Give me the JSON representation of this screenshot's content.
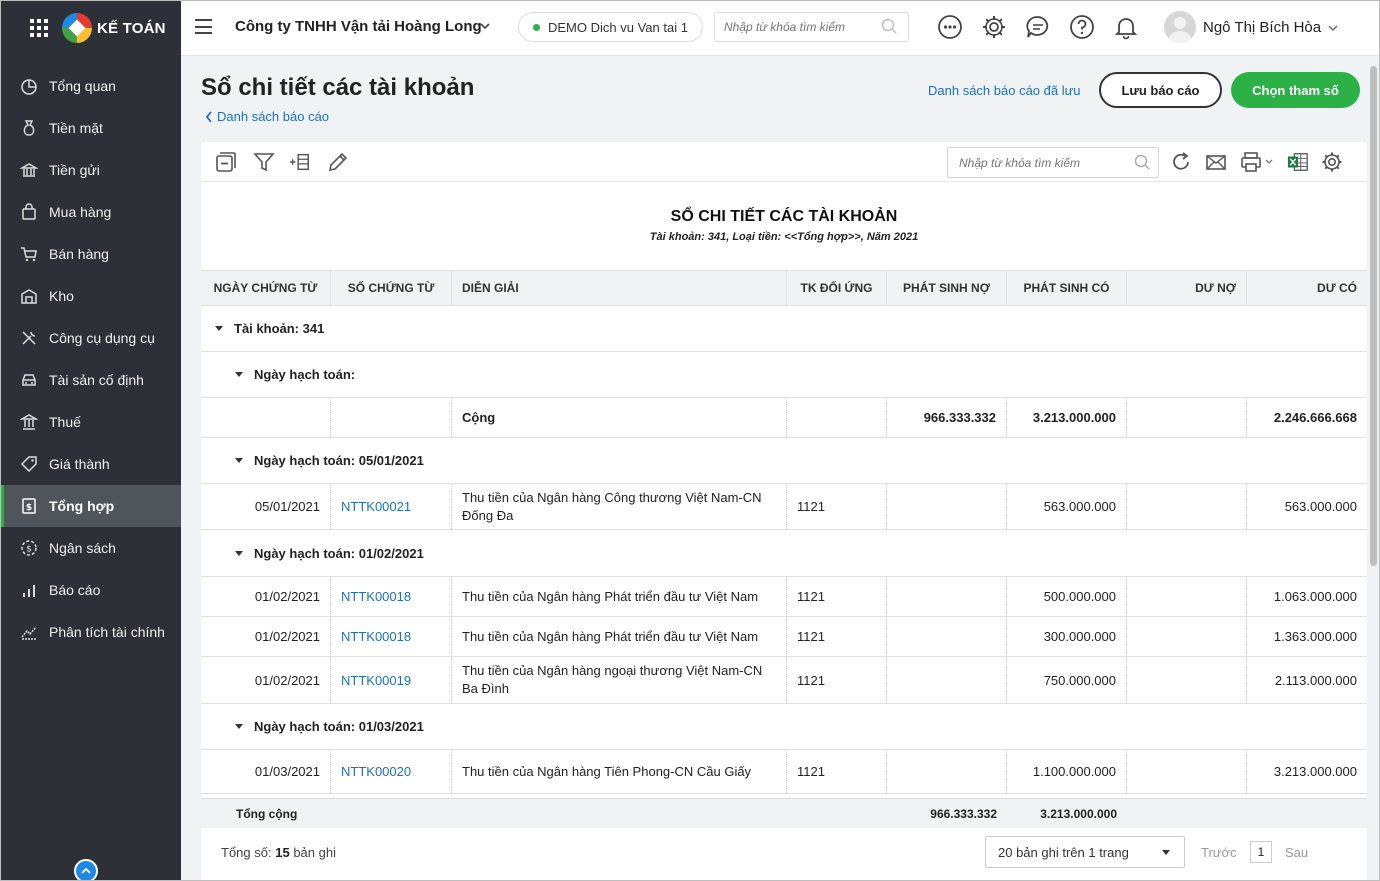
{
  "sidebar": {
    "brand": "KẾ TOÁN",
    "items": [
      {
        "label": "Tổng quan",
        "icon": "dashboard-icon"
      },
      {
        "label": "Tiền mặt",
        "icon": "cash-bag-icon"
      },
      {
        "label": "Tiền gửi",
        "icon": "bank-icon"
      },
      {
        "label": "Mua hàng",
        "icon": "shopping-bag-icon"
      },
      {
        "label": "Bán hàng",
        "icon": "cart-icon"
      },
      {
        "label": "Kho",
        "icon": "warehouse-icon"
      },
      {
        "label": "Công cụ dụng cụ",
        "icon": "tools-icon"
      },
      {
        "label": "Tài sản cố định",
        "icon": "car-icon"
      },
      {
        "label": "Thuế",
        "icon": "tax-building-icon"
      },
      {
        "label": "Giá thành",
        "icon": "price-tag-icon"
      },
      {
        "label": "Tổng hợp",
        "icon": "ledger-icon",
        "active": true
      },
      {
        "label": "Ngân sách",
        "icon": "budget-coin-icon"
      },
      {
        "label": "Báo cáo",
        "icon": "bar-chart-icon"
      },
      {
        "label": "Phân tích tài chính",
        "icon": "trend-chart-icon"
      }
    ]
  },
  "topbar": {
    "company": "Công ty TNHH Vận tải Hoàng Long",
    "demo_label": "DEMO Dich vu Van tai 1",
    "search_placeholder": "Nhập từ khóa tìm kiếm",
    "username": "Ngô Thị Bích Hòa"
  },
  "page": {
    "title": "Sổ chi tiết các tài khoản",
    "back_link": "Danh sách báo cáo",
    "saved_reports_link": "Danh sách báo cáo đã lưu",
    "save_button": "Lưu báo cáo",
    "param_button": "Chọn tham số"
  },
  "toolbar": {
    "search_placeholder": "Nhập từ khóa tìm kiếm"
  },
  "report": {
    "title": "SỔ CHI TIẾT CÁC TÀI KHOẢN",
    "subtitle": "Tài khoản: 341, Loại tiền: <<Tổng hợp>>, Năm 2021"
  },
  "table": {
    "headers": {
      "date": "NGÀY CHỨNG TỪ",
      "voucher": "SỐ CHỨNG TỪ",
      "desc": "DIỄN GIẢI",
      "corr": "TK ĐỐI ỨNG",
      "debit": "PHÁT SINH NỢ",
      "credit": "PHÁT SINH CÓ",
      "bal_debit": "DƯ NỢ",
      "bal_credit": "DƯ CÓ"
    },
    "account_group": "Tài khoản: 341",
    "group_opening": "Ngày hạch toán:",
    "sum_row": {
      "label": "Cộng",
      "debit": "966.333.332",
      "credit": "3.213.000.000",
      "bal_credit": "2.246.666.668"
    },
    "group_1": "Ngày hạch toán: 05/01/2021",
    "row_1": {
      "date": "05/01/2021",
      "voucher": "NTTK00021",
      "desc": "Thu tiền của Ngân hàng Công thương Việt Nam-CN Đống Đa",
      "corr": "1121",
      "credit": "563.000.000",
      "bal_credit": "563.000.000"
    },
    "group_2": "Ngày hạch toán: 01/02/2021",
    "row_2": {
      "date": "01/02/2021",
      "voucher": "NTTK00018",
      "desc": "Thu tiền của Ngân hàng Phát triển đầu tư Việt Nam",
      "corr": "1121",
      "credit": "500.000.000",
      "bal_credit": "1.063.000.000"
    },
    "row_3": {
      "date": "01/02/2021",
      "voucher": "NTTK00018",
      "desc": "Thu tiền của Ngân hàng Phát triển đầu tư Việt Nam",
      "corr": "1121",
      "credit": "300.000.000",
      "bal_credit": "1.363.000.000"
    },
    "row_4": {
      "date": "01/02/2021",
      "voucher": "NTTK00019",
      "desc": "Thu tiền của Ngân hàng ngoại thương Việt Nam-CN Ba Đình",
      "corr": "1121",
      "credit": "750.000.000",
      "bal_credit": "2.113.000.000"
    },
    "group_3": "Ngày hạch toán: 01/03/2021",
    "row_5": {
      "date": "01/03/2021",
      "voucher": "NTTK00020",
      "desc": "Thu tiền của Ngân hàng Tiên Phong-CN Cầu Giấy",
      "corr": "1121",
      "credit": "1.100.000.000",
      "bal_credit": "3.213.000.000"
    }
  },
  "totals": {
    "label": "Tổng cộng",
    "debit": "966.333.332",
    "credit": "3.213.000.000"
  },
  "footer": {
    "count_prefix": "Tổng số:",
    "count_value": "15",
    "count_suffix": "bản ghi",
    "page_size": "20 bản ghi trên 1 trang",
    "prev": "Trước",
    "page": "1",
    "next": "Sau"
  }
}
